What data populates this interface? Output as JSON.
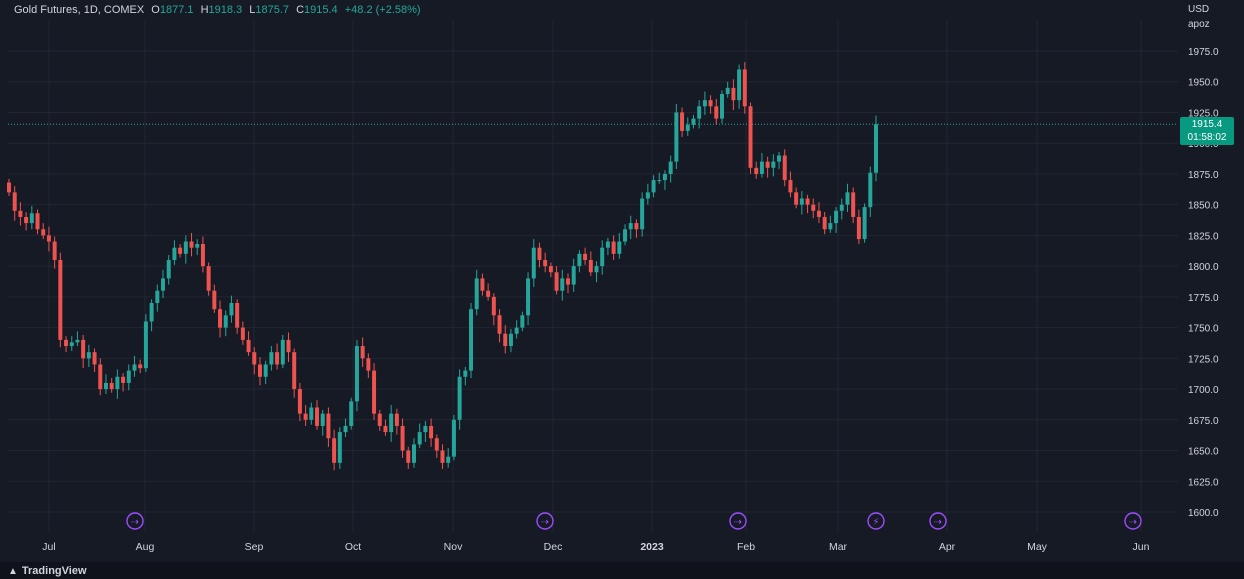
{
  "header": {
    "symbol": "Gold Futures, 1D, COMEX",
    "o_label": "O",
    "o_value": "1877.1",
    "h_label": "H",
    "h_value": "1918.3",
    "l_label": "L",
    "l_value": "1875.7",
    "c_label": "C",
    "c_value": "1915.4",
    "change": "+48.2 (+2.58%)"
  },
  "axis": {
    "currency": "USD",
    "extra": "apoz"
  },
  "last_price": {
    "value": "1915.4",
    "countdown": "01:58:02"
  },
  "footer": {
    "brand": "TradingView"
  },
  "colors": {
    "up": "#26a69a",
    "down": "#ef5350",
    "background": "#161a25",
    "grid": "#232632",
    "event": "#9c4dff"
  },
  "chart_data": {
    "type": "candlestick",
    "y_ticks": [
      "1975.0",
      "1950.0",
      "1925.0",
      "1900.0",
      "1875.0",
      "1850.0",
      "1825.0",
      "1800.0",
      "1775.0",
      "1750.0",
      "1725.0",
      "1700.0",
      "1675.0",
      "1650.0",
      "1625.0",
      "1600.0"
    ],
    "ylim": [
      1595,
      1985
    ],
    "x_ticks": [
      "Jul",
      "Aug",
      "Sep",
      "Oct",
      "Nov",
      "Dec",
      "2023",
      "Feb",
      "Mar",
      "Apr",
      "May",
      "Jun"
    ],
    "events": [
      "forward",
      "forward",
      "forward",
      "lightning",
      "forward",
      "forward"
    ],
    "close": [
      1860,
      1845,
      1840,
      1835,
      1843,
      1830,
      1825,
      1820,
      1805,
      1740,
      1735,
      1738,
      1740,
      1725,
      1730,
      1720,
      1700,
      1705,
      1700,
      1710,
      1705,
      1715,
      1720,
      1717,
      1755,
      1770,
      1780,
      1790,
      1805,
      1815,
      1810,
      1820,
      1815,
      1818,
      1800,
      1780,
      1765,
      1750,
      1760,
      1770,
      1750,
      1740,
      1730,
      1720,
      1710,
      1720,
      1730,
      1720,
      1740,
      1730,
      1700,
      1680,
      1675,
      1685,
      1670,
      1680,
      1660,
      1640,
      1665,
      1670,
      1690,
      1735,
      1725,
      1715,
      1680,
      1670,
      1665,
      1680,
      1670,
      1650,
      1640,
      1655,
      1665,
      1670,
      1660,
      1650,
      1640,
      1645,
      1675,
      1710,
      1715,
      1765,
      1790,
      1780,
      1775,
      1760,
      1745,
      1735,
      1745,
      1750,
      1760,
      1790,
      1815,
      1805,
      1800,
      1795,
      1780,
      1790,
      1785,
      1800,
      1810,
      1805,
      1795,
      1800,
      1815,
      1820,
      1810,
      1820,
      1830,
      1835,
      1830,
      1855,
      1860,
      1870,
      1870,
      1875,
      1885,
      1925,
      1910,
      1915,
      1920,
      1930,
      1935,
      1930,
      1920,
      1940,
      1945,
      1935,
      1960,
      1930,
      1880,
      1875,
      1885,
      1880,
      1885,
      1890,
      1870,
      1860,
      1850,
      1855,
      1850,
      1845,
      1840,
      1830,
      1835,
      1845,
      1850,
      1860,
      1840,
      1822,
      1848,
      1876,
      1915.4
    ]
  }
}
